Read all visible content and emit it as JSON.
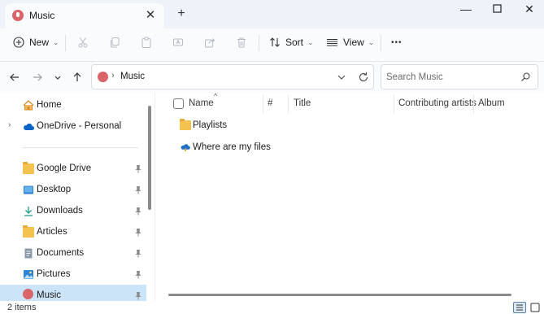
{
  "window": {
    "tab_title": "Music",
    "new_tab_symbol": "+"
  },
  "commands": {
    "new_label": "New",
    "sort_label": "Sort",
    "view_label": "View",
    "more_symbol": "•••"
  },
  "address": {
    "current_folder": "Music",
    "separator": "›"
  },
  "search": {
    "placeholder": "Search Music"
  },
  "sidebar": {
    "items": [
      {
        "label": "Home",
        "icon": "home-icon"
      },
      {
        "label": "OneDrive - Personal",
        "icon": "cloud-icon"
      },
      {
        "label": "Google Drive",
        "icon": "folder-icon",
        "pinned": true
      },
      {
        "label": "Desktop",
        "icon": "desktop-icon",
        "pinned": true
      },
      {
        "label": "Downloads",
        "icon": "download-icon",
        "pinned": true
      },
      {
        "label": "Articles",
        "icon": "folder-icon",
        "pinned": true
      },
      {
        "label": "Documents",
        "icon": "document-icon",
        "pinned": true
      },
      {
        "label": "Pictures",
        "icon": "pictures-icon",
        "pinned": true
      },
      {
        "label": "Music",
        "icon": "music-icon",
        "pinned": true,
        "selected": true
      }
    ]
  },
  "columns": {
    "name": "Name",
    "number": "#",
    "title": "Title",
    "artists": "Contributing artists",
    "album": "Album",
    "sort_indicator": "^"
  },
  "files": [
    {
      "name": "Playlists",
      "icon": "folder-icon"
    },
    {
      "name": "Where are my files",
      "icon": "onedrive-help-icon"
    }
  ],
  "status": {
    "item_count": "2 items"
  },
  "colors": {
    "selection": "#cce4f7",
    "folder": "#f3c24f",
    "accent": "#0a64c8"
  }
}
